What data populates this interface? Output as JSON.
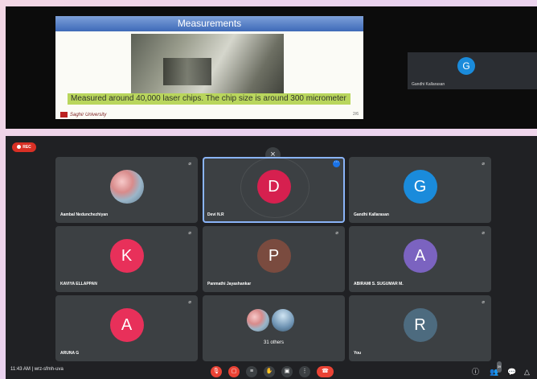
{
  "presentation": {
    "title": "Measurements",
    "caption": "Measured around 40,000 laser chips.  The chip size is around 300 micrometer",
    "footer": "Saghir University",
    "page": "2/6",
    "side_tile": {
      "initial": "G",
      "name": "Gandhi Kallarasan",
      "color": "#1a8bdb"
    }
  },
  "meeting": {
    "rec_label": "REC",
    "close_symbol": "×",
    "tiles": [
      {
        "name": "Aambal Nedunchezhiyan",
        "initial": "",
        "color": "",
        "photo": true
      },
      {
        "name": "Devi N.R",
        "initial": "D",
        "color": "#d6204f",
        "active": true
      },
      {
        "name": "Gandhi Kallarasan",
        "initial": "G",
        "color": "#1a8bdb"
      },
      {
        "name": "KAVIYA ELLAPPAN",
        "initial": "K",
        "color": "#e8305a"
      },
      {
        "name": "Panmathi Jayashankar",
        "initial": "P",
        "color": "#7a4b3f"
      },
      {
        "name": "ABIRAMI S. SUGUMAR M.",
        "initial": "A",
        "color": "#7b63c0"
      },
      {
        "name": "ARUNA G",
        "initial": "A",
        "color": "#e8305a"
      },
      {
        "name": "",
        "initial": "",
        "color": "",
        "group": true,
        "others_label": "31 others"
      },
      {
        "name": "You",
        "initial": "R",
        "color": "#4d6b7f"
      }
    ],
    "bottom_bar": {
      "time": "11:43 AM",
      "separator": "|",
      "meeting_code": "wrz-sfmh-uva",
      "participant_count": "39"
    }
  }
}
